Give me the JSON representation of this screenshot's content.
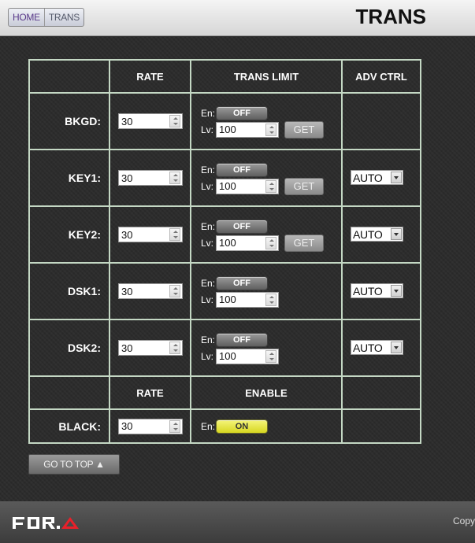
{
  "header": {
    "breadcrumb": [
      "HOME",
      "TRANS"
    ],
    "title": "TRANS"
  },
  "table": {
    "headers": [
      "",
      "RATE",
      "TRANS LIMIT",
      "ADV CTRL"
    ],
    "rows": [
      {
        "label": "BKGD:",
        "rate": "30",
        "en_label": "En:",
        "en": "OFF",
        "lv_label": "Lv:",
        "lv": "100",
        "get": "GET",
        "adv": ""
      },
      {
        "label": "KEY1:",
        "rate": "30",
        "en_label": "En:",
        "en": "OFF",
        "lv_label": "Lv:",
        "lv": "100",
        "get": "GET",
        "adv": "AUTO"
      },
      {
        "label": "KEY2:",
        "rate": "30",
        "en_label": "En:",
        "en": "OFF",
        "lv_label": "Lv:",
        "lv": "100",
        "get": "GET",
        "adv": "AUTO"
      },
      {
        "label": "DSK1:",
        "rate": "30",
        "en_label": "En:",
        "en": "OFF",
        "lv_label": "Lv:",
        "lv": "100",
        "get": "",
        "adv": "AUTO"
      },
      {
        "label": "DSK2:",
        "rate": "30",
        "en_label": "En:",
        "en": "OFF",
        "lv_label": "Lv:",
        "lv": "100",
        "get": "",
        "adv": "AUTO"
      }
    ],
    "headers2": [
      "",
      "RATE",
      "ENABLE",
      ""
    ],
    "black": {
      "label": "BLACK:",
      "rate": "30",
      "en_label": "En:",
      "en": "ON"
    }
  },
  "buttons": {
    "go_to_top": "GO TO TOP ▲"
  },
  "footer": {
    "logo": "FOR-A",
    "copy": "Copy"
  },
  "colors": {
    "toggle_on": "#e8e830",
    "toggle_off": "#7a7a7a",
    "grid_border": "#c4d8c4"
  }
}
